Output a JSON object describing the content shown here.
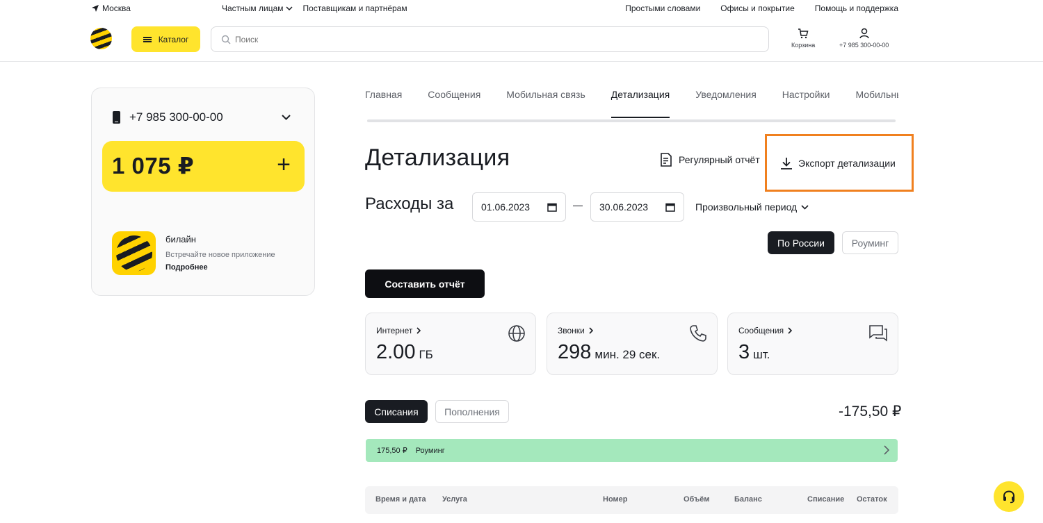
{
  "topbar": {
    "city": "Москва",
    "segment_private": "Частным лицам",
    "segment_partners": "Поставщикам и партнёрам",
    "link_simple": "Простыми словами",
    "link_offices": "Офисы и покрытие",
    "link_help": "Помощь и поддержка"
  },
  "header": {
    "catalog_label": "Каталог",
    "search_placeholder": "Поиск",
    "cart_label": "Корзина",
    "account_label": "+7 985 300-00-00"
  },
  "sidebar": {
    "phone": "+7 985 300-00-00",
    "balance": "1 075 ₽",
    "balance_add": "+",
    "app_title": "билайн",
    "app_subtitle": "Встречайте новое приложение",
    "app_link": "Подробнее"
  },
  "tabs": [
    {
      "label": "Главная",
      "active": false
    },
    {
      "label": "Сообщения",
      "active": false
    },
    {
      "label": "Мобильная связь",
      "active": false
    },
    {
      "label": "Детализация",
      "active": true
    },
    {
      "label": "Уведомления",
      "active": false
    },
    {
      "label": "Настройки",
      "active": false
    },
    {
      "label": "Мобильный ID",
      "active": false
    }
  ],
  "main": {
    "title": "Детализация",
    "regular_report": "Регулярный отчёт",
    "export": "Экспорт детализации",
    "expenses_label": "Расходы за",
    "date_from": "01.06.2023",
    "date_to": "30.06.2023",
    "period": "Произвольный период",
    "scope_russia": "По России",
    "scope_roaming": "Роуминг",
    "make_report": "Составить отчёт"
  },
  "stats": [
    {
      "label": "Интернет",
      "value": "2.00",
      "unit": "ГБ",
      "icon": "globe-icon"
    },
    {
      "label": "Звонки",
      "value": "298",
      "unit": "мин. 29 сек.",
      "icon": "phone-call-icon"
    },
    {
      "label": "Сообщения",
      "value": "3",
      "unit": "шт.",
      "icon": "chat-icon"
    }
  ],
  "operations": {
    "tab_debits": "Списания",
    "tab_credits": "Пополнения",
    "total": "-175,50 ₽",
    "row_amount": "175,50 ₽",
    "row_type": "Роуминг"
  },
  "table": {
    "columns": [
      "Время и дата",
      "Услуга",
      "Номер",
      "Объём",
      "Баланс",
      "Списание",
      "Остаток"
    ]
  },
  "colors": {
    "brand_yellow": "#ffe42d",
    "dark": "#191c22",
    "highlight_orange": "#f0801f",
    "roaming_green": "#a4e8bc"
  }
}
